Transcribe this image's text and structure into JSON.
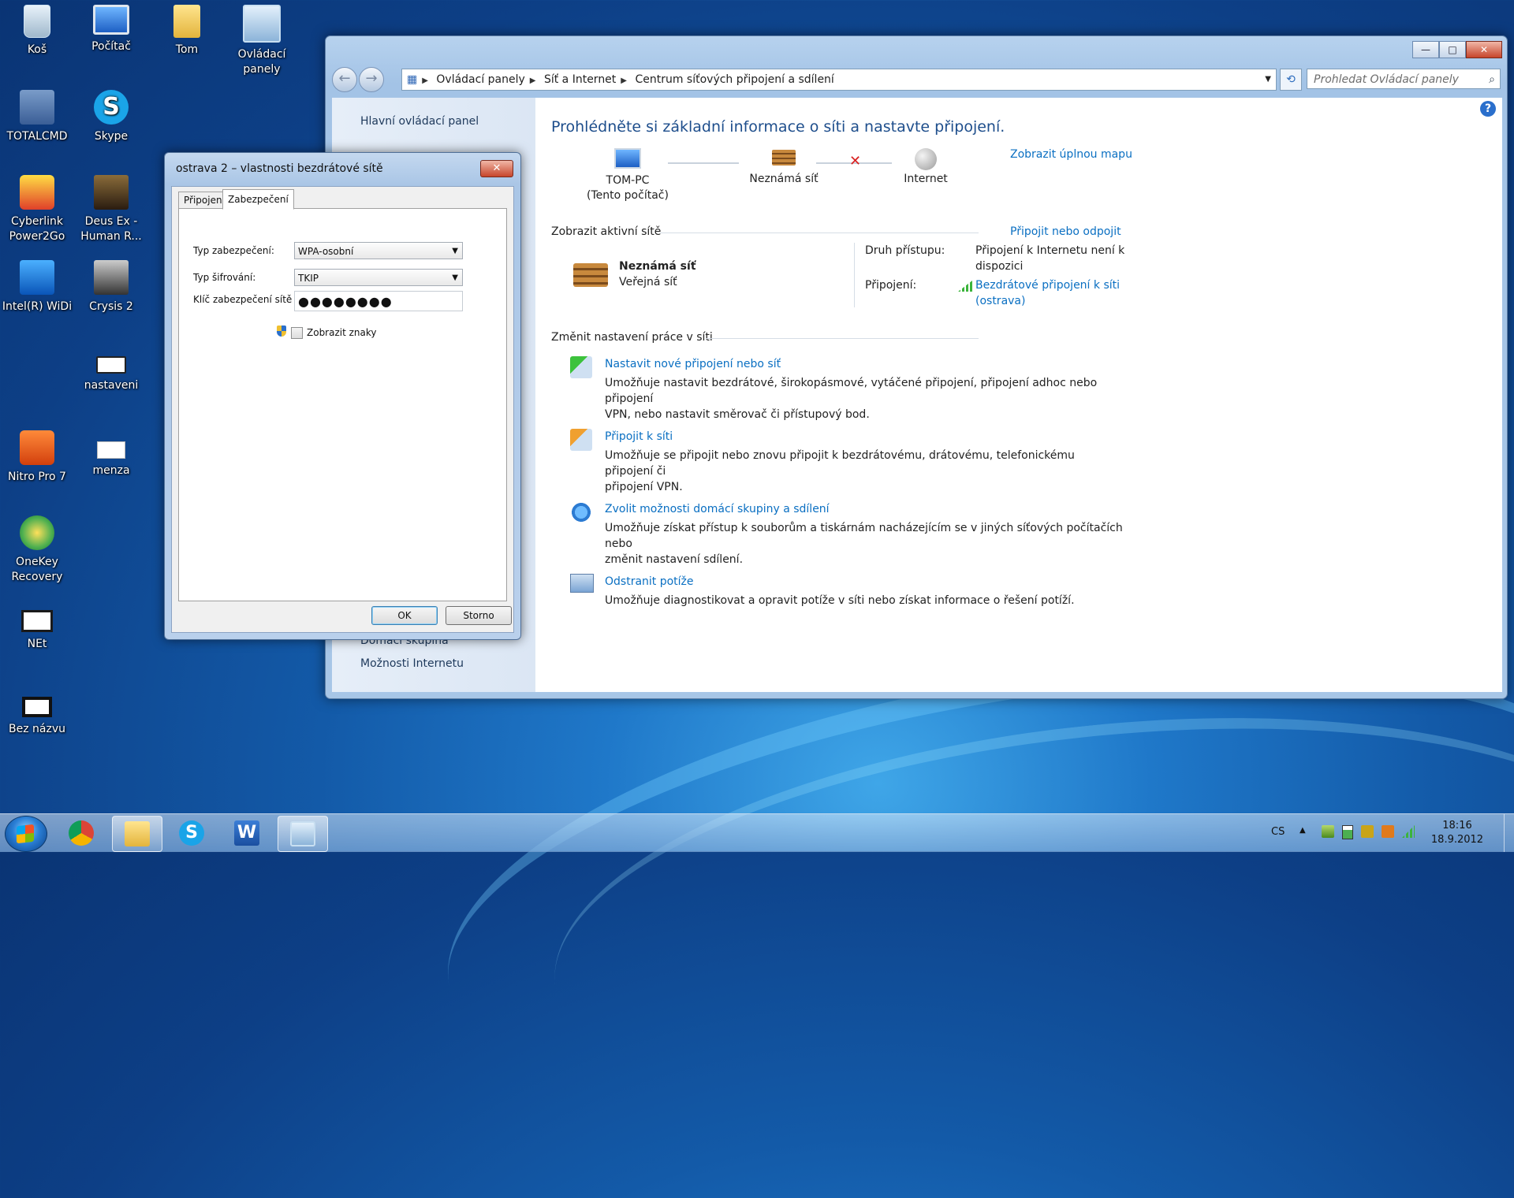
{
  "desktop": {
    "icons": [
      {
        "label": "Koš",
        "icon": "recycle-bin-icon"
      },
      {
        "label": "Počítač",
        "icon": "computer-icon"
      },
      {
        "label": "Tom",
        "icon": "user-folder-icon"
      },
      {
        "label": "Ovládací panely",
        "icon": "control-panel-icon"
      },
      {
        "label": "TOTALCMD",
        "icon": "total-commander-icon"
      },
      {
        "label": "Skype",
        "icon": "skype-icon"
      },
      {
        "label": "Cyberlink Power2Go",
        "icon": "power2go-icon"
      },
      {
        "label": "Deus Ex - Human R...",
        "icon": "deus-ex-icon"
      },
      {
        "label": "Intel(R) WiDi",
        "icon": "intel-widi-icon"
      },
      {
        "label": "Crysis 2",
        "icon": "crysis-icon"
      },
      {
        "label": "nastaveni",
        "icon": "notepad-file-icon"
      },
      {
        "label": "Nitro Pro 7",
        "icon": "nitro-pro-icon"
      },
      {
        "label": "menza",
        "icon": "text-file-icon"
      },
      {
        "label": "OneKey Recovery",
        "icon": "onekey-recovery-icon"
      },
      {
        "label": "NEt",
        "icon": "net-file-icon"
      },
      {
        "label": "Bez názvu",
        "icon": "untitled-file-icon"
      }
    ]
  },
  "window": {
    "caption_buttons": {
      "minimize": "—",
      "maximize": "□",
      "close": "✕"
    },
    "nav": {
      "back": "←",
      "forward": "→"
    },
    "breadcrumb": [
      "Ovládací panely",
      "Síť a Internet",
      "Centrum síťových připojení a sdílení"
    ],
    "search_placeholder": "Prohledat Ovládací panely",
    "help": "?",
    "left_pane": {
      "home": "Hlavní ovládací panel",
      "see_also_1": "Domácí skupina",
      "see_also_2": "Možnosti Internetu"
    },
    "heading": "Prohlédněte si základní informace o síti a nastavte připojení.",
    "map": {
      "node1_name": "TOM-PC",
      "node1_sub": "(Tento počítač)",
      "node2_name": "Neznámá síť",
      "node3_name": "Internet",
      "full_map_link": "Zobrazit úplnou mapu"
    },
    "active": {
      "section_title": "Zobrazit aktivní sítě",
      "connect_link": "Připojit nebo odpojit",
      "network_name": "Neznámá síť",
      "network_type": "Veřejná síť",
      "access_label": "Druh přístupu:",
      "access_value_1": "Připojení k Internetu není k",
      "access_value_2": "dispozici",
      "connections_label": "Připojení:",
      "connection_value_1": "Bezdrátové připojení k síti",
      "connection_value_2": "(ostrava)"
    },
    "change": {
      "section_title": "Změnit nastavení práce v síti",
      "tasks": [
        {
          "title": "Nastavit nové připojení nebo síť",
          "desc1": "Umožňuje nastavit bezdrátové, širokopásmové, vytáčené připojení, připojení adhoc nebo připojení",
          "desc2": "VPN, nebo nastavit směrovač či přístupový bod."
        },
        {
          "title": "Připojit k síti",
          "desc1": "Umožňuje se připojit nebo znovu připojit k bezdrátovému, drátovému, telefonickému připojení či",
          "desc2": "připojení VPN."
        },
        {
          "title": "Zvolit možnosti domácí skupiny a sdílení",
          "desc1": "Umožňuje získat přístup k souborům a tiskárnám nacházejícím se v jiných síťových počítačích nebo",
          "desc2": "změnit nastavení sdílení."
        },
        {
          "title": "Odstranit potíže",
          "desc1": "Umožňuje diagnostikovat a opravit potíže v síti nebo získat informace o řešení potíží.",
          "desc2": ""
        }
      ]
    }
  },
  "dialog": {
    "title": "ostrava 2 – vlastnosti bezdrátové sítě",
    "close": "✕",
    "tabs": [
      "Připojení",
      "Zabezpečení"
    ],
    "security_type_label": "Typ zabezpečení:",
    "security_type_value": "WPA-osobní",
    "encryption_label": "Typ šifrování:",
    "encryption_value": "TKIP",
    "key_label": "Klíč zabezpečení sítě",
    "key_value": "●●●●●●●●",
    "show_chars_label": "Zobrazit znaky",
    "show_chars_checked": false,
    "ok": "OK",
    "cancel": "Storno"
  },
  "taskbar": {
    "apps": [
      "chrome-icon",
      "explorer-icon",
      "skype-icon",
      "word-icon",
      "control-panel-icon"
    ],
    "language": "CS",
    "tray_expand": "▲",
    "time": "18:16",
    "date": "18.9.2012"
  }
}
